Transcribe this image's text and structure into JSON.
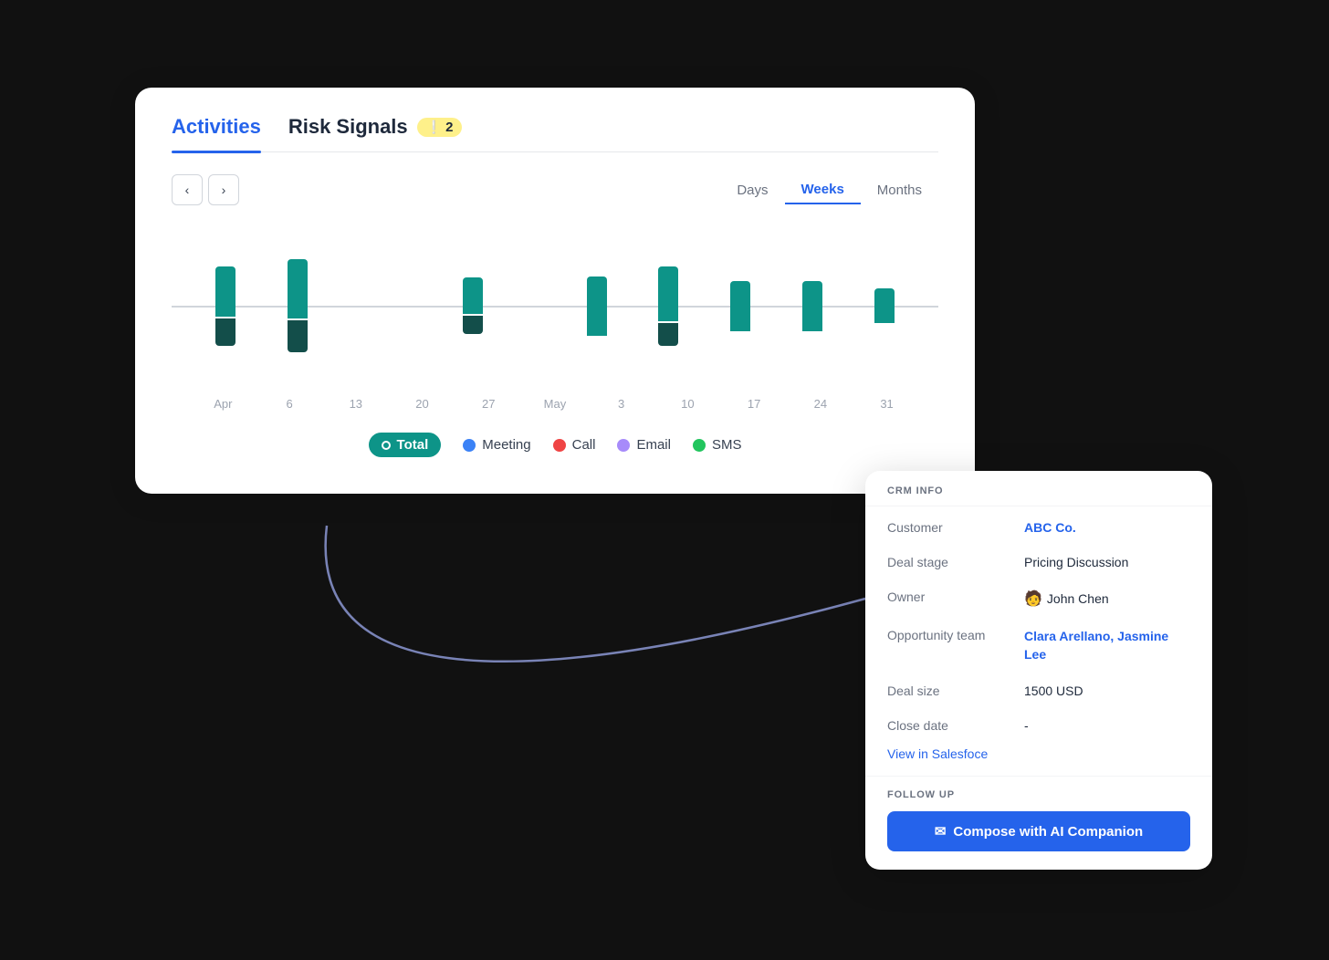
{
  "tabs": {
    "activities_label": "Activities",
    "risk_signals_label": "Risk Signals",
    "risk_count": "2"
  },
  "period_controls": {
    "days_label": "Days",
    "weeks_label": "Weeks",
    "months_label": "Months",
    "active": "Weeks"
  },
  "chart": {
    "bars": [
      {
        "label": "Apr",
        "upper": 55,
        "lower": 30
      },
      {
        "label": "6",
        "upper": 65,
        "lower": 35
      },
      {
        "label": "13",
        "upper": 0,
        "lower": 0
      },
      {
        "label": "20",
        "upper": 0,
        "lower": 0
      },
      {
        "label": "27",
        "upper": 40,
        "lower": 20
      },
      {
        "label": "May",
        "upper": 0,
        "lower": 0
      },
      {
        "label": "3",
        "upper": 65,
        "lower": 0
      },
      {
        "label": "10",
        "upper": 60,
        "lower": 25
      },
      {
        "label": "17",
        "upper": 55,
        "lower": 0
      },
      {
        "label": "24",
        "upper": 55,
        "lower": 0
      },
      {
        "label": "31",
        "upper": 38,
        "lower": 0
      }
    ],
    "legend": {
      "total": "Total",
      "meeting": "Meeting",
      "call": "Call",
      "email": "Email",
      "sms": "SMS"
    }
  },
  "crm_info": {
    "section_title": "CRM INFO",
    "customer_label": "Customer",
    "customer_value": "ABC Co.",
    "deal_stage_label": "Deal stage",
    "deal_stage_value": "Pricing Discussion",
    "owner_label": "Owner",
    "owner_value": "John Chen",
    "opp_team_label": "Opportunity team",
    "opp_team_value": "Clara Arellano, Jasmine Lee",
    "deal_size_label": "Deal size",
    "deal_size_value": "1500 USD",
    "close_date_label": "Close date",
    "close_date_value": "-",
    "salesforce_link": "View in Salesfoce"
  },
  "follow_up": {
    "section_title": "FOLLOW UP",
    "compose_button": "Compose with AI Companion"
  }
}
